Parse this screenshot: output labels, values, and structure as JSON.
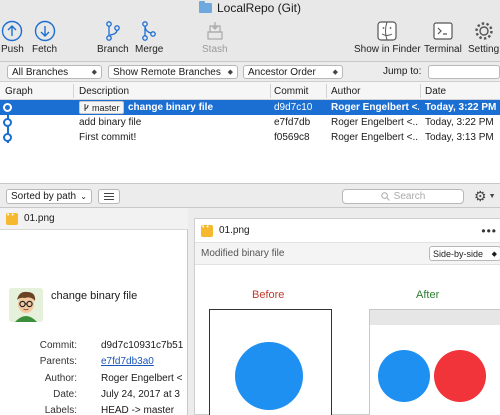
{
  "window": {
    "title": "LocalRepo (Git)"
  },
  "toolbar": {
    "push": "Push",
    "fetch": "Fetch",
    "branch": "Branch",
    "merge": "Merge",
    "stash": "Stash",
    "show_in_finder": "Show in Finder",
    "terminal": "Terminal",
    "settings": "Setting"
  },
  "filters": {
    "branches": "All Branches",
    "remote": "Show Remote Branches",
    "order": "Ancestor Order",
    "jump_to_label": "Jump to:",
    "jump_to_value": ""
  },
  "table": {
    "headers": {
      "graph": "Graph",
      "description": "Description",
      "commit": "Commit",
      "author": "Author",
      "date": "Date"
    },
    "rows": [
      {
        "branch": "master",
        "description": "change binary file",
        "commit": "d9d7c10",
        "author": "Roger Engelbert <...",
        "date": "Today, 3:22 PM"
      },
      {
        "description": "add binary file",
        "commit": "e7fd7db",
        "author": "Roger Engelbert <...",
        "date": "Today, 3:22 PM"
      },
      {
        "description": "First commit!",
        "commit": "f0569c8",
        "author": "Roger Engelbert <...",
        "date": "Today, 3:13 PM"
      }
    ]
  },
  "bottombar": {
    "sort": "Sorted by path",
    "search_placeholder": "Search"
  },
  "files": {
    "selected": "01.png"
  },
  "details": {
    "message": "change binary file",
    "commit_label": "Commit:",
    "commit_value": "d9d7c10931c7b51",
    "parents_label": "Parents:",
    "parents_value": "e7fd7db3a0",
    "author_label": "Author:",
    "author_value": "Roger Engelbert <",
    "date_label": "Date:",
    "date_value": "July 24, 2017 at 3",
    "labels_label": "Labels:",
    "labels_value": "HEAD -> master"
  },
  "diff": {
    "file": "01.png",
    "status": "Modified binary file",
    "mode": "Side-by-side",
    "before_label": "Before",
    "after_label": "After"
  },
  "colors": {
    "selection": "#1c6fd2",
    "before_circle": "#1e90f2",
    "after_red_circle": "#f0343a",
    "before_label": "#c0392b",
    "after_label": "#2e7d32"
  }
}
